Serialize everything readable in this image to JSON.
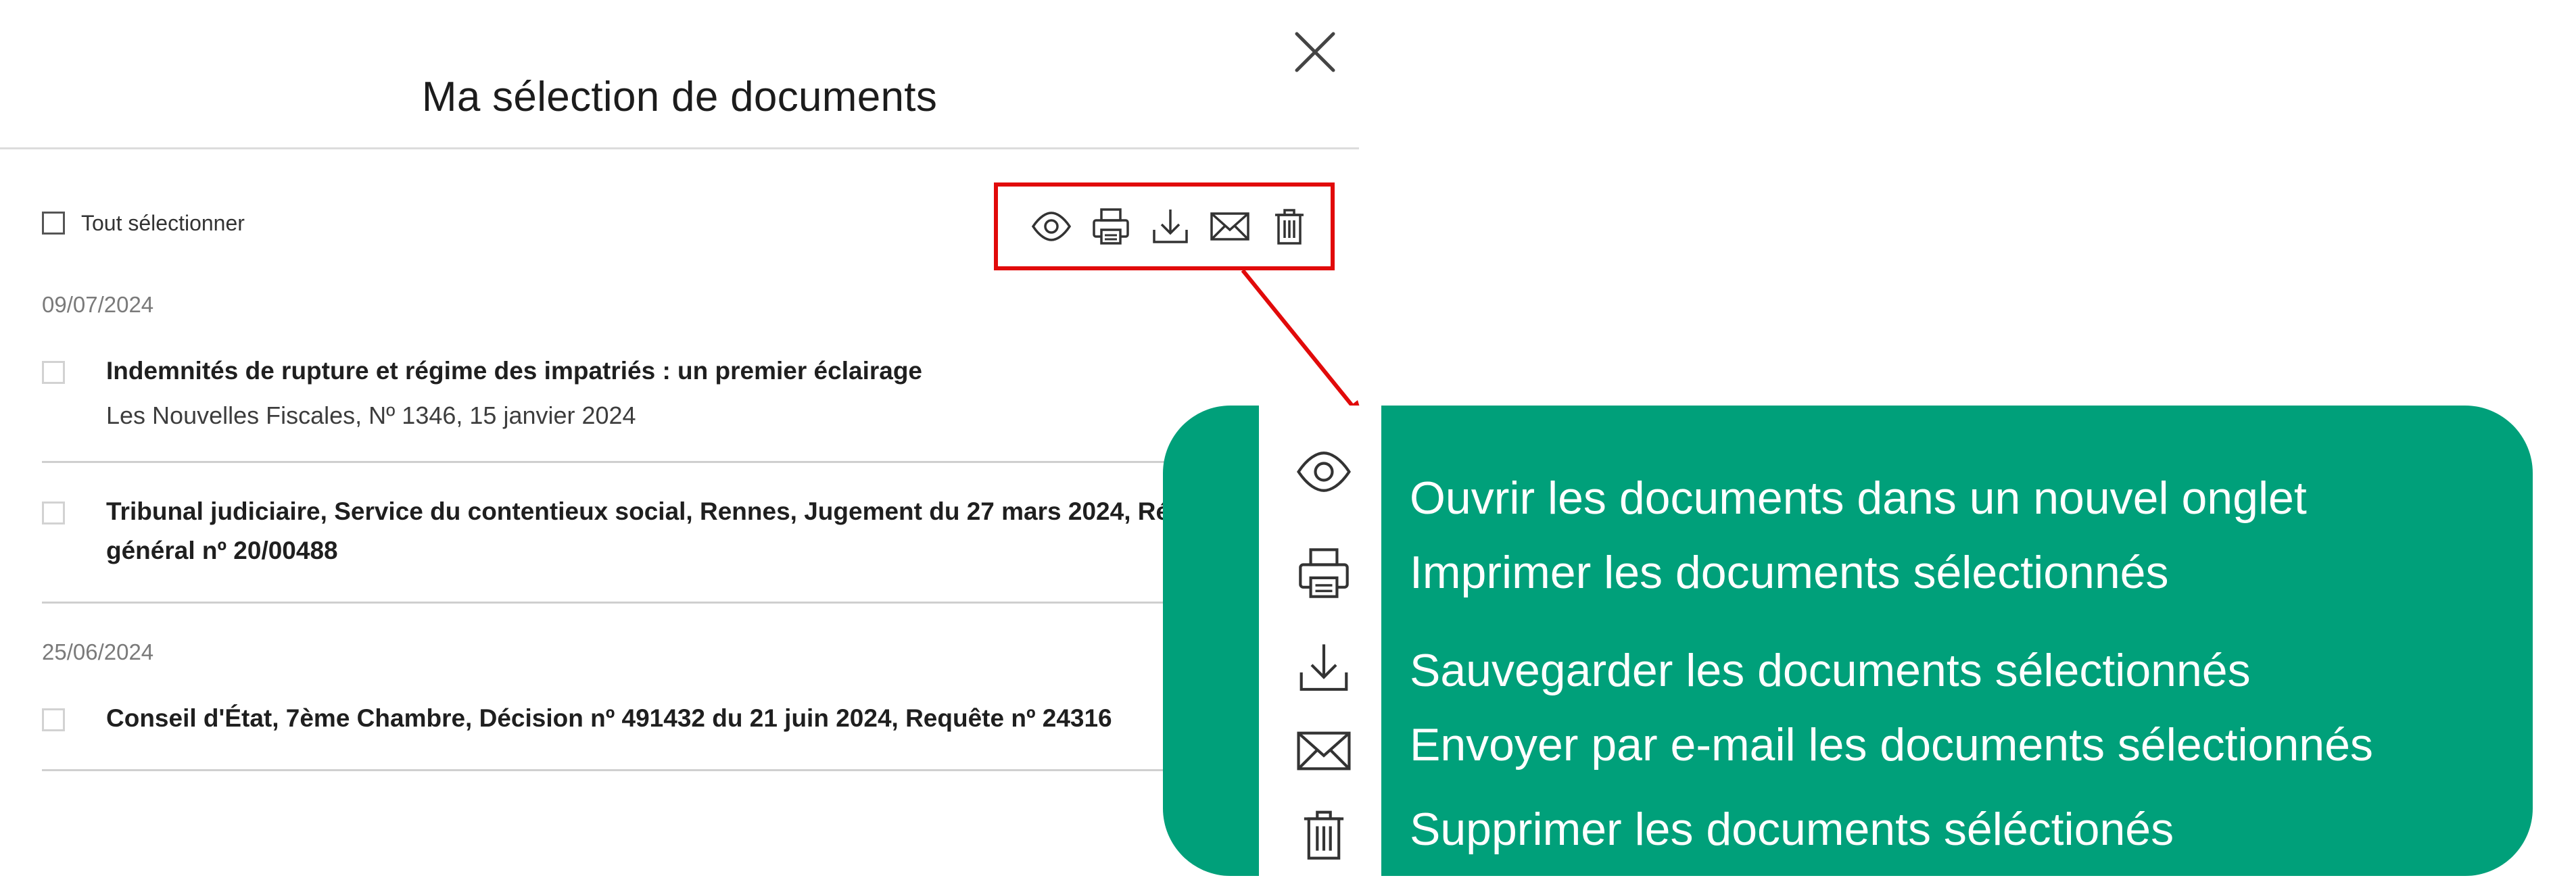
{
  "modal": {
    "title": "Ma sélection de documents",
    "select_all_label": "Tout sélectionner",
    "toolbar": [
      {
        "icon": "eye-icon",
        "action": "view"
      },
      {
        "icon": "printer-icon",
        "action": "print"
      },
      {
        "icon": "download-icon",
        "action": "download"
      },
      {
        "icon": "mail-icon",
        "action": "email"
      },
      {
        "icon": "trash-icon",
        "action": "delete"
      }
    ],
    "groups": [
      {
        "date": "09/07/2024",
        "documents": [
          {
            "title": "Indemnités de rupture et régime des impatriés : un premier éclairage",
            "subtitle": "Les Nouvelles Fiscales, Nº 1346, 15 janvier 2024"
          },
          {
            "title_line1": "Tribunal judiciaire, Service du contentieux social, Rennes, Jugement du 27 mars 2024, Ré",
            "title_line2": "général nº 20/00488"
          }
        ]
      },
      {
        "date": "25/06/2024",
        "documents": [
          {
            "title": "Conseil d'État, 7ème Chambre, Décision nº 491432 du 21 juin 2024, Requête nº 24316"
          }
        ]
      }
    ]
  },
  "legend": {
    "items": [
      {
        "icon": "eye-icon",
        "text": "Ouvrir les documents dans un nouvel onglet"
      },
      {
        "icon": "printer-icon",
        "text": "Imprimer les documents sélectionnés"
      },
      {
        "icon": "download-icon",
        "text": "Sauvegarder les documents sélectionnés"
      },
      {
        "icon": "mail-icon",
        "text": "Envoyer par e-mail les documents sélectionnés"
      },
      {
        "icon": "trash-icon",
        "text": "Supprimer les documents séléctionés"
      }
    ]
  },
  "colors": {
    "legend_background": "#00a07a",
    "highlight_border": "#e10a0a",
    "divider": "#cfcfcf"
  }
}
